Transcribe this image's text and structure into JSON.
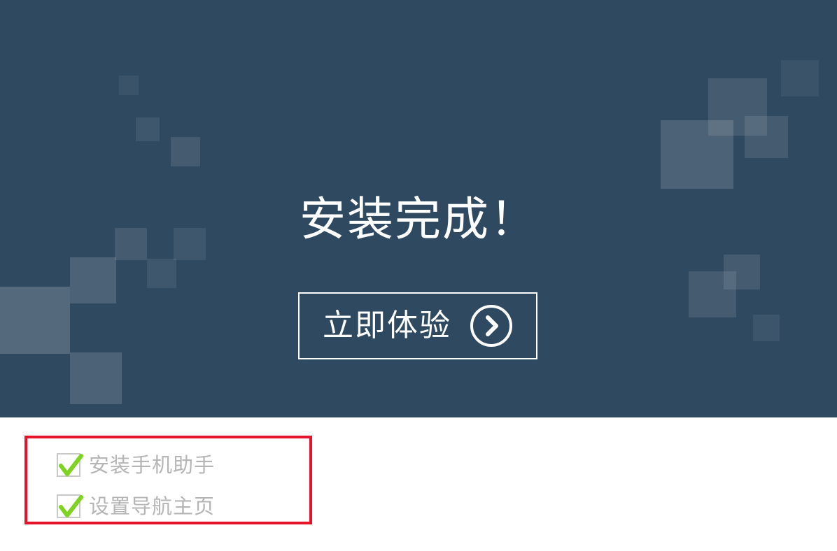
{
  "banner": {
    "title": "安装完成！",
    "cta_label": "立即体验",
    "background_color": "#2f4960"
  },
  "icons": {
    "cta": "chevron-right-circle-icon",
    "checkbox_mark": "checkmark-icon"
  },
  "options": [
    {
      "label": "安装手机助手",
      "checked": true
    },
    {
      "label": "设置导航主页",
      "checked": true
    }
  ],
  "colors": {
    "highlight_border": "#e5142b",
    "check_green": "#7ed321",
    "option_text": "#b5b5b5"
  }
}
